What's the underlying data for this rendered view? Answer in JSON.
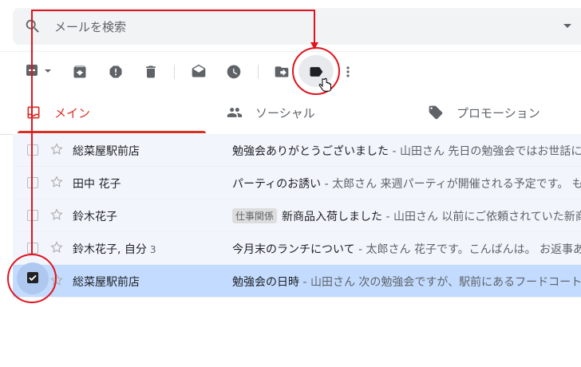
{
  "search": {
    "placeholder": "メールを検索"
  },
  "icons": {
    "search": "search-icon",
    "archive": "archive-icon",
    "spam": "report-spam-icon",
    "delete": "delete-icon",
    "mark_read": "mark-as-read-icon",
    "snooze": "snooze-icon",
    "move": "move-to-icon",
    "label": "label-icon",
    "more": "more-vert-icon"
  },
  "tabs": [
    {
      "label": "メイン",
      "icon": "inbox-icon"
    },
    {
      "label": "ソーシャル",
      "icon": "people-icon"
    },
    {
      "label": "プロモーション",
      "icon": "tag-icon"
    }
  ],
  "emails": [
    {
      "sender": "総菜屋駅前店",
      "count": "",
      "tag": "",
      "subject": "勉強会ありがとうございました",
      "snippet": " - 山田さん 先日の勉強会ではお世話に"
    },
    {
      "sender": "田中 花子",
      "count": "",
      "tag": "",
      "subject": "パーティのお誘い",
      "snippet": " - 太郎さん 来週パーティが開催される予定です。 も"
    },
    {
      "sender": "鈴木花子",
      "count": "",
      "tag": "仕事関係",
      "subject": "新商品入荷しました",
      "snippet": " - 山田さん 以前にご依頼されていた新商"
    },
    {
      "sender": "鈴木花子, 自分",
      "count": "3",
      "tag": "",
      "subject": "今月末のランチについて",
      "snippet": " - 太郎さん 花子です。こんばんは。 お返事あ"
    },
    {
      "sender": "総菜屋駅前店",
      "count": "",
      "tag": "",
      "subject": "勉強会の日時",
      "snippet": " - 山田さん 次の勉強会ですが、駅前にあるフードコート",
      "selected": true
    }
  ],
  "colors": {
    "accent": "#d93025",
    "selected_row": "#c2dbff",
    "annotation": "#e0141e"
  }
}
